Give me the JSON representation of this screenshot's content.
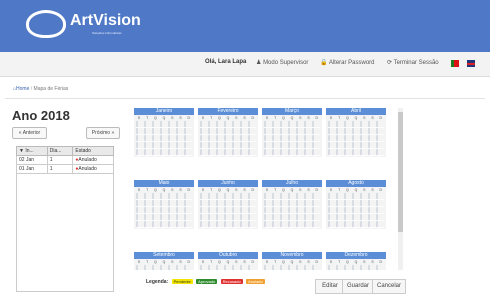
{
  "header": {
    "logo_text": "ArtVision",
    "logo_sub": "Soluções Informáticas"
  },
  "topbar": {
    "user": "Olá, Lara Lapa",
    "supervisor": "Modo Supervisor",
    "change_password": "Alterar Password",
    "logout": "Terminar Sessão"
  },
  "breadcrumb": {
    "home": "Home",
    "current": "Mapa de Férias"
  },
  "year": {
    "title": "Ano 2018",
    "prev": "« Anterior",
    "next": "Próximo »"
  },
  "list": {
    "headers": [
      "▼ In...",
      "Dia...",
      "Estado"
    ],
    "rows": [
      {
        "inicio": "02 Jan",
        "dias": "1",
        "estado": "Anulado"
      },
      {
        "inicio": "01 Jan",
        "dias": "1",
        "estado": "Anulado"
      }
    ]
  },
  "calendar": {
    "months": [
      "Janeiro",
      "Fevereiro",
      "Março",
      "Abril",
      "Maio",
      "Junho",
      "Julho",
      "Agosto",
      "Setembro",
      "Outubro",
      "Novembro",
      "Dezembro"
    ],
    "dow": [
      "S",
      "T",
      "Q",
      "Q",
      "S",
      "S",
      "D"
    ]
  },
  "legend": {
    "label": "Legenda:",
    "items": [
      "Pendente",
      "Aprovado",
      "Recusado",
      "Anulado"
    ]
  },
  "actions": {
    "edit": "Editar",
    "save": "Guardar",
    "cancel": "Cancelar"
  },
  "colors": {
    "header": "#4f78c7",
    "month_header": "#5b8ed6",
    "pendente": "#f2e600",
    "aprovado": "#2e8b2e",
    "recusado": "#e03030",
    "anulado": "#f0a030"
  }
}
